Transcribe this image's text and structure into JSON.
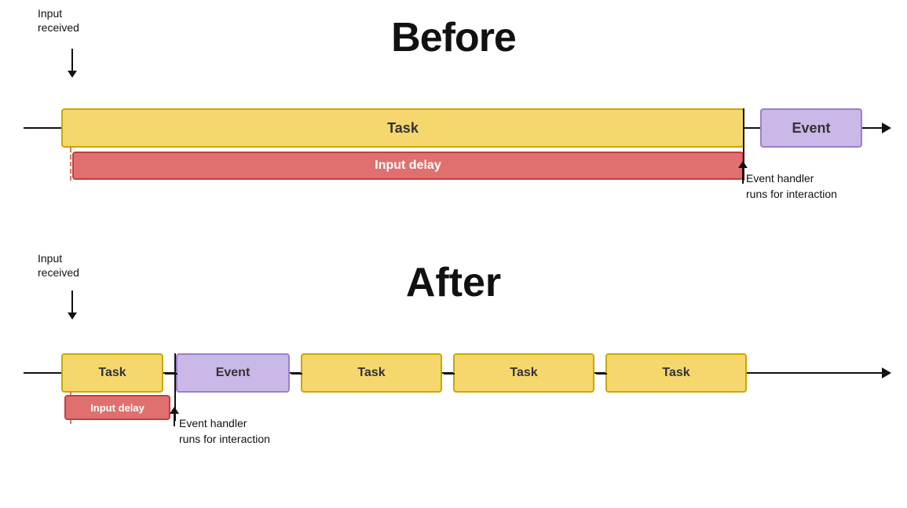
{
  "before": {
    "title": "Before",
    "input_received": "Input\nreceived",
    "task_label": "Task",
    "event_label": "Event",
    "input_delay_label": "Input delay",
    "event_handler_label": "Event handler\nruns for interaction"
  },
  "after": {
    "title": "After",
    "input_received": "Input\nreceived",
    "task_label": "Task",
    "event_label": "Event",
    "task2_label": "Task",
    "task3_label": "Task",
    "task4_label": "Task",
    "input_delay_label": "Input delay",
    "event_handler_label": "Event handler\nruns for interaction"
  },
  "colors": {
    "task_bg": "#f5d76e",
    "task_border": "#c8a800",
    "event_bg": "#c9b8e8",
    "event_border": "#9b7fc9",
    "delay_bg": "#e07070",
    "delay_border": "#c04040"
  }
}
